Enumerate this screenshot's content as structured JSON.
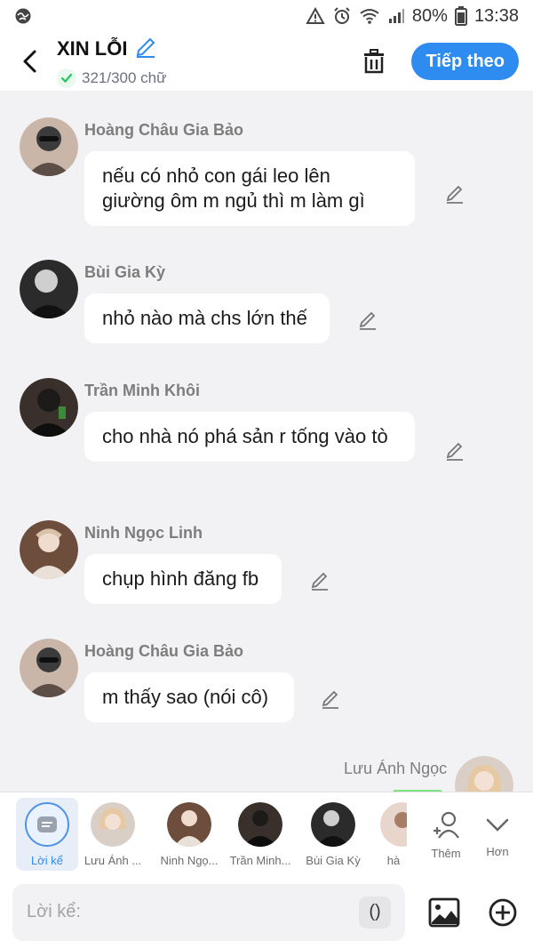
{
  "status": {
    "battery": "80%",
    "time": "13:38"
  },
  "header": {
    "title": "XIN LỖI",
    "counter": "321/300 chữ",
    "next_label": "Tiếp theo"
  },
  "messages": [
    {
      "name": "Hoàng Châu Gia Bảo",
      "text": "nếu có nhỏ con gái leo lên giường ôm m ngủ thì m làm gì"
    },
    {
      "name": "Bùi Gia Kỳ",
      "text": "nhỏ nào mà chs lớn thế"
    },
    {
      "name": "Trần Minh Khôi",
      "text": "cho nhà nó phá sản r tống vào tò"
    },
    {
      "name": "Ninh Ngọc Linh",
      "text": "chụp hình đăng fb"
    },
    {
      "name": "Hoàng Châu Gia Bảo",
      "text": "m thấy sao (nói cô)"
    },
    {
      "name": "Lưu Ánh Ngọc",
      "text": ""
    }
  ],
  "narrator": {
    "label": "Lời kể"
  },
  "characters": [
    {
      "label": "Lưu Ánh ..."
    },
    {
      "label": "Ninh Ngọ..."
    },
    {
      "label": "Trần Minh..."
    },
    {
      "label": "Bùi Gia Kỳ"
    },
    {
      "label": "hà"
    }
  ],
  "tools": {
    "more_people": "Thêm",
    "expand": "Hơn"
  },
  "composer": {
    "placeholder": "Lời kể:",
    "bracket": "()"
  },
  "colors": {
    "accent": "#2e8bf0",
    "background": "#f2f2f4",
    "bubble": "#ffffff",
    "name_text": "#7d7d7d"
  }
}
